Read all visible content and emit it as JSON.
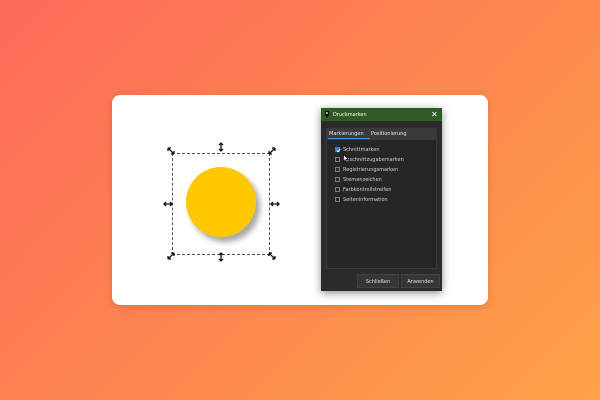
{
  "dialog": {
    "title": "Druckmarken",
    "close_glyph": "✕",
    "tabs": [
      {
        "label": "Markierungen",
        "active": true
      },
      {
        "label": "Positionierung",
        "active": false
      }
    ],
    "options": [
      {
        "label": "Schnittmarken",
        "checked": true
      },
      {
        "label": "Beschnittzugabemarken",
        "checked": false
      },
      {
        "label": "Registrierungsmarken",
        "checked": false
      },
      {
        "label": "Sternenzeichen",
        "checked": false
      },
      {
        "label": "Farbkontrollstreifen",
        "checked": false
      },
      {
        "label": "Seiteninformation",
        "checked": false
      }
    ],
    "buttons": {
      "close_label": "Schließen",
      "apply_label": "Anwenden"
    }
  },
  "canvas": {
    "shape": "circle",
    "shape_color": "#ffc800",
    "selection_handles": [
      "nw",
      "n",
      "ne",
      "w",
      "e",
      "sw",
      "s",
      "se"
    ]
  },
  "colors": {
    "titlebar": "#2f5a24",
    "dialog_bg": "#2b2b2b",
    "accent": "#2f7fd6"
  },
  "icons": {
    "app": "app-icon",
    "close": "close-icon",
    "check": "check-icon",
    "cursor": "mouse-cursor-icon",
    "handle": "resize-arrow-icon"
  }
}
